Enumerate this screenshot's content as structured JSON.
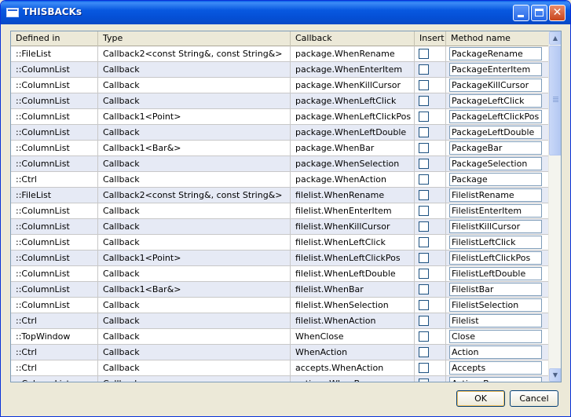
{
  "window": {
    "title": "THISBACKs"
  },
  "columns": [
    "Defined in",
    "Type",
    "Callback",
    "Insert",
    "Method name"
  ],
  "rows": [
    [
      "::FileList",
      "Callback2<const String&, const String&>",
      "package.WhenRename",
      "PackageRename"
    ],
    [
      "::ColumnList",
      "Callback",
      "package.WhenEnterItem",
      "PackageEnterItem"
    ],
    [
      "::ColumnList",
      "Callback",
      "package.WhenKillCursor",
      "PackageKillCursor"
    ],
    [
      "::ColumnList",
      "Callback",
      "package.WhenLeftClick",
      "PackageLeftClick"
    ],
    [
      "::ColumnList",
      "Callback1<Point>",
      "package.WhenLeftClickPos",
      "PackageLeftClickPos"
    ],
    [
      "::ColumnList",
      "Callback",
      "package.WhenLeftDouble",
      "PackageLeftDouble"
    ],
    [
      "::ColumnList",
      "Callback1<Bar&>",
      "package.WhenBar",
      "PackageBar"
    ],
    [
      "::ColumnList",
      "Callback",
      "package.WhenSelection",
      "PackageSelection"
    ],
    [
      "::Ctrl",
      "Callback",
      "package.WhenAction",
      "Package"
    ],
    [
      "::FileList",
      "Callback2<const String&, const String&>",
      "filelist.WhenRename",
      "FilelistRename"
    ],
    [
      "::ColumnList",
      "Callback",
      "filelist.WhenEnterItem",
      "FilelistEnterItem"
    ],
    [
      "::ColumnList",
      "Callback",
      "filelist.WhenKillCursor",
      "FilelistKillCursor"
    ],
    [
      "::ColumnList",
      "Callback",
      "filelist.WhenLeftClick",
      "FilelistLeftClick"
    ],
    [
      "::ColumnList",
      "Callback1<Point>",
      "filelist.WhenLeftClickPos",
      "FilelistLeftClickPos"
    ],
    [
      "::ColumnList",
      "Callback",
      "filelist.WhenLeftDouble",
      "FilelistLeftDouble"
    ],
    [
      "::ColumnList",
      "Callback1<Bar&>",
      "filelist.WhenBar",
      "FilelistBar"
    ],
    [
      "::ColumnList",
      "Callback",
      "filelist.WhenSelection",
      "FilelistSelection"
    ],
    [
      "::Ctrl",
      "Callback",
      "filelist.WhenAction",
      "Filelist"
    ],
    [
      "::TopWindow",
      "Callback",
      "WhenClose",
      "Close"
    ],
    [
      "::Ctrl",
      "Callback",
      "WhenAction",
      "Action"
    ],
    [
      "::Ctrl",
      "Callback",
      "accepts.WhenAction",
      "Accepts"
    ],
    [
      "::ColumnList",
      "Callback",
      "actions.WhenBar",
      "ActionsBar"
    ]
  ],
  "buttons": {
    "ok": "OK",
    "cancel": "Cancel"
  },
  "icons": {
    "close": "close-icon",
    "minimize": "minimize-icon",
    "maximize": "maximize-icon",
    "scroll_up": "arrow-up-icon",
    "scroll_down": "arrow-down-icon"
  },
  "colors": {
    "title_bar": "#0554d9",
    "row_alt": "#e6eaf5",
    "button_border": "#003c74"
  }
}
